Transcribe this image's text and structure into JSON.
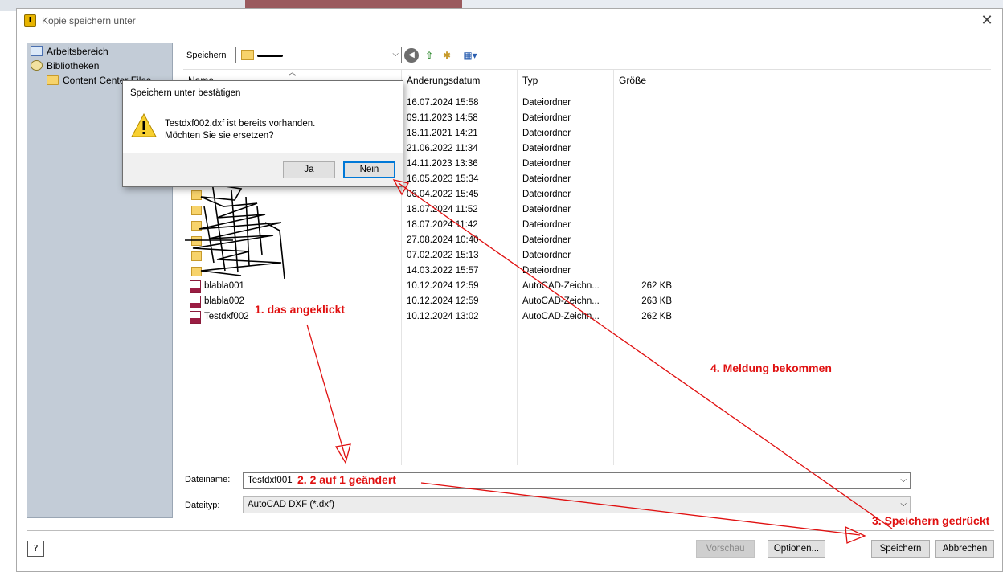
{
  "window": {
    "title": "Kopie speichern unter",
    "close": "✕"
  },
  "places": [
    {
      "label": "Arbeitsbereich",
      "icon": "workspace-icon"
    },
    {
      "label": "Bibliotheken",
      "icon": "libraries-icon"
    },
    {
      "label": "Content Center Files",
      "icon": "folder-icon"
    }
  ],
  "toolbar": {
    "save_in_label": "Speichern"
  },
  "columns": {
    "name": "Name",
    "date": "Änderungsdatum",
    "type": "Typ",
    "size": "Größe"
  },
  "rows": [
    {
      "name": "",
      "date": "16.07.2024 15:58",
      "type": "Dateiordner",
      "size": "",
      "kind": "folder"
    },
    {
      "name": "",
      "date": "09.11.2023 14:58",
      "type": "Dateiordner",
      "size": "",
      "kind": "folder"
    },
    {
      "name": "",
      "date": "18.11.2021 14:21",
      "type": "Dateiordner",
      "size": "",
      "kind": "folder"
    },
    {
      "name": "",
      "date": "21.06.2022 11:34",
      "type": "Dateiordner",
      "size": "",
      "kind": "folder"
    },
    {
      "name": "",
      "date": "14.11.2023 13:36",
      "type": "Dateiordner",
      "size": "",
      "kind": "folder"
    },
    {
      "name": "",
      "date": "16.05.2023 15:34",
      "type": "Dateiordner",
      "size": "",
      "kind": "folder"
    },
    {
      "name": "",
      "date": "06.04.2022 15:45",
      "type": "Dateiordner",
      "size": "",
      "kind": "folder"
    },
    {
      "name": "",
      "date": "18.07.2024 11:52",
      "type": "Dateiordner",
      "size": "",
      "kind": "folder"
    },
    {
      "name": "",
      "date": "18.07.2024 11:42",
      "type": "Dateiordner",
      "size": "",
      "kind": "folder"
    },
    {
      "name": "",
      "date": "27.08.2024 10:40",
      "type": "Dateiordner",
      "size": "",
      "kind": "folder"
    },
    {
      "name": "",
      "date": "07.02.2022 15:13",
      "type": "Dateiordner",
      "size": "",
      "kind": "folder"
    },
    {
      "name": "",
      "date": "14.03.2022 15:57",
      "type": "Dateiordner",
      "size": "",
      "kind": "folder"
    },
    {
      "name": "blabla001",
      "date": "10.12.2024 12:59",
      "type": "AutoCAD-Zeichn...",
      "size": "262 KB",
      "kind": "dxf"
    },
    {
      "name": "blabla002",
      "date": "10.12.2024 12:59",
      "type": "AutoCAD-Zeichn...",
      "size": "263 KB",
      "kind": "dxf"
    },
    {
      "name": "Testdxf002",
      "date": "10.12.2024 13:02",
      "type": "AutoCAD-Zeichn...",
      "size": "262 KB",
      "kind": "dxf"
    }
  ],
  "form": {
    "filename_label": "Dateiname:",
    "filename_value": "Testdxf001",
    "filetype_label": "Dateityp:",
    "filetype_value": "AutoCAD DXF (*.dxf)"
  },
  "buttons": {
    "help": "?",
    "preview": "Vorschau",
    "options": "Optionen...",
    "save": "Speichern",
    "cancel": "Abbrechen"
  },
  "confirm_dialog": {
    "title": "Speichern unter bestätigen",
    "message_line1": "Testdxf002.dxf ist bereits vorhanden.",
    "message_line2": "Möchten Sie sie ersetzen?",
    "yes": "Ja",
    "no": "Nein"
  },
  "annotations": {
    "a1": "1. das angeklickt",
    "a2": "2. 2 auf 1 geändert",
    "a3": "3. Speichern gedrückt",
    "a4": "4. Meldung bekommen",
    "color": "#e01010"
  }
}
